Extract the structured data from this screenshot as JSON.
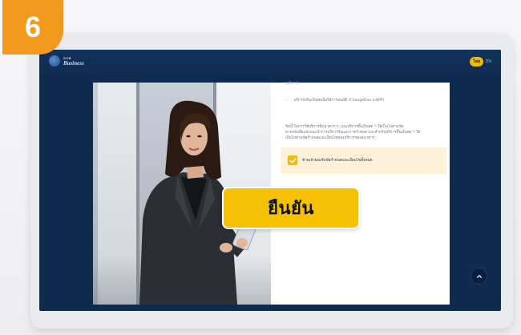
{
  "step_badge": "6",
  "app": {
    "brand_small": "SCB",
    "brand_name": "Business",
    "lang_active": "ไทย",
    "lang_other": "EN"
  },
  "terms": {
    "top_line": "(บริการ)",
    "bullet": "บริการปรับเงินสดเมื่อให้การอนุมัติ (ChangeDue e-BPP)",
    "paragraph_1": "ข้อนี้ ในการใช้บริการที่ธนาคาร ก. และบริการพื้นเงินสด ฯ ให้เป็นไปตามข้อ",
    "paragraph_2": "ตามหนังสือแจ้งแนะนำการบริการรับและการกำหนด และสำหรับบริการพื้นเงินสด ฯ ให้",
    "paragraph_3": "เป็นไปตามข้อกำหนดและเงื่อนไขของบริการของธนาคาร"
  },
  "consent": {
    "checked": true,
    "label": "ข้าพเจ้ายอมรับข้อกำหนดและเงื่อนไขทั้งหมด"
  },
  "confirm_button": "ยืนยัน",
  "colors": {
    "badge": "#f39a1e",
    "accent_yellow": "#f6c103",
    "navy": "#0e2a4f"
  },
  "icons": {
    "checkbox": "check-icon",
    "fab": "chevron-up-icon"
  }
}
